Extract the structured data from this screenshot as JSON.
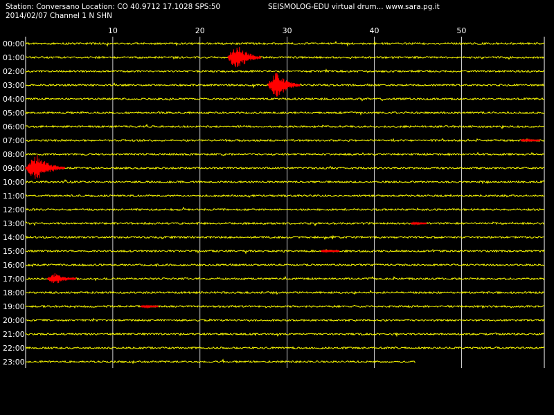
{
  "header": {
    "station_line": "Station: Conversano Location: CO 40.9712 17.1028 SPS:50",
    "date_line": "2014/02/07  Channel 1 N SHN",
    "brand_line": "SEISMOLOG-EDU virtual drum... www.sara.pg.it"
  },
  "colors": {
    "background": "#000000",
    "trace": "#ffff00",
    "event": "#ff0000",
    "grid": "#ffffff",
    "text": "#ffffff"
  },
  "chart_data": {
    "type": "line",
    "title": "",
    "x_unit": "minute",
    "xlim": [
      0,
      59.5
    ],
    "x_ticks": [
      10,
      20,
      30,
      40,
      50
    ],
    "grid": true,
    "rows": [
      "00:00",
      "01:00",
      "02:00",
      "03:00",
      "04:00",
      "05:00",
      "06:00",
      "07:00",
      "08:00",
      "09:00",
      "10:00",
      "11:00",
      "12:00",
      "13:00",
      "14:00",
      "15:00",
      "16:00",
      "17:00",
      "18:00",
      "19:00",
      "20:00",
      "21:00",
      "22:00",
      "23:00"
    ],
    "last_row_end_minute": 44.8,
    "events": [
      {
        "row": "01:00",
        "start_minute": 23.2,
        "end_minute": 27.0,
        "amplitude": "large"
      },
      {
        "row": "03:00",
        "start_minute": 27.8,
        "end_minute": 31.5,
        "amplitude": "large"
      },
      {
        "row": "07:00",
        "start_minute": 56.8,
        "end_minute": 59.0,
        "amplitude": "small"
      },
      {
        "row": "09:00",
        "start_minute": 0.0,
        "end_minute": 4.5,
        "amplitude": "large"
      },
      {
        "row": "13:00",
        "start_minute": 44.2,
        "end_minute": 46.0,
        "amplitude": "small"
      },
      {
        "row": "15:00",
        "start_minute": 33.9,
        "end_minute": 36.0,
        "amplitude": "small"
      },
      {
        "row": "17:00",
        "start_minute": 2.5,
        "end_minute": 5.8,
        "amplitude": "medium"
      },
      {
        "row": "19:00",
        "start_minute": 13.2,
        "end_minute": 15.2,
        "amplitude": "small"
      }
    ]
  }
}
